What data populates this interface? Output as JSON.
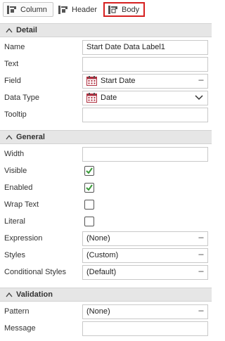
{
  "tabs": {
    "column_label": "Column",
    "header_label": "Header",
    "body_label": "Body",
    "selected": "Body"
  },
  "sections": {
    "detail": {
      "title": "Detail",
      "name_label": "Name",
      "name_value": "Start Date Data Label1",
      "text_label": "Text",
      "text_value": "",
      "field_label": "Field",
      "field_value": "Start Date",
      "field_icon": "calendar-icon",
      "datatype_label": "Data Type",
      "datatype_value": "Date",
      "tooltip_label": "Tooltip",
      "tooltip_value": ""
    },
    "general": {
      "title": "General",
      "width_label": "Width",
      "width_value": "",
      "visible_label": "Visible",
      "visible_checked": true,
      "enabled_label": "Enabled",
      "enabled_checked": true,
      "wraptext_label": "Wrap Text",
      "wraptext_checked": false,
      "literal_label": "Literal",
      "literal_checked": false,
      "expression_label": "Expression",
      "expression_value": "(None)",
      "styles_label": "Styles",
      "styles_value": "(Custom)",
      "condstyles_label": "Conditional Styles",
      "condstyles_value": "(Default)"
    },
    "validation": {
      "title": "Validation",
      "pattern_label": "Pattern",
      "pattern_value": "(None)",
      "message_label": "Message",
      "message_value": ""
    }
  },
  "ellipsis": "---",
  "colors": {
    "check": "#3a9a3a",
    "selected_tab_border": "#d62020",
    "section_bg": "#e6e6e6"
  }
}
